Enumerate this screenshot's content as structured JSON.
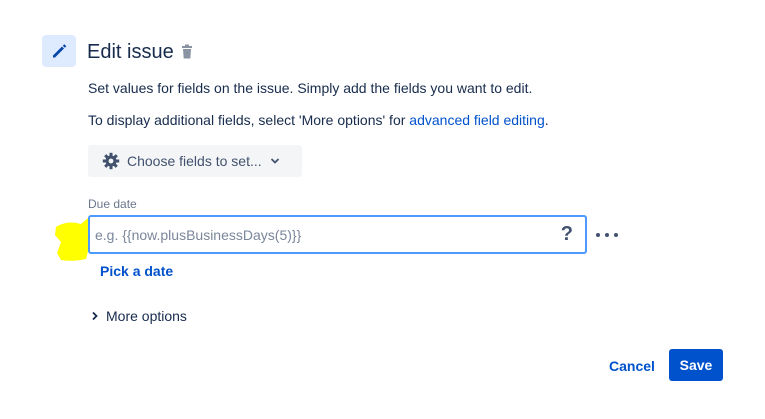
{
  "header": {
    "title": "Edit issue",
    "icons": [
      "pencil-icon",
      "trash-icon"
    ]
  },
  "description": {
    "line1": "Set values for fields on the issue. Simply add the fields you want to edit.",
    "line2_prefix": "To display additional fields, select 'More options' for ",
    "line2_link": "advanced field editing",
    "line2_suffix": "."
  },
  "choose_fields": {
    "label": "Choose fields to set...",
    "icons": [
      "gear-icon",
      "chevron-down-icon"
    ]
  },
  "due_date": {
    "label": "Due date",
    "value": "",
    "placeholder": "e.g. {{now.plusBusinessDays(5)}}",
    "help_glyph": "?",
    "pick_date_label": "Pick a date"
  },
  "more_options": {
    "label": "More options"
  },
  "footer": {
    "cancel_label": "Cancel",
    "save_label": "Save"
  },
  "colors": {
    "accent": "#0052cc",
    "focus_border": "#4c9aff",
    "icon_bg": "#deebff",
    "highlight": "#ffff00"
  }
}
